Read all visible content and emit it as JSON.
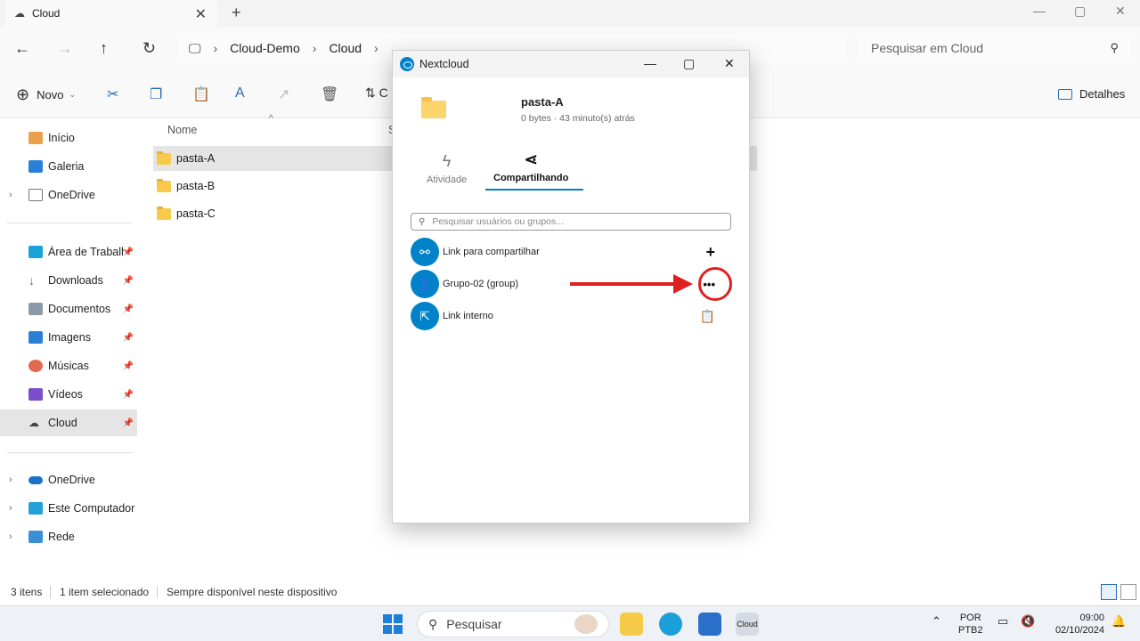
{
  "window": {
    "tab_title": "Cloud",
    "close": "✕",
    "new_tab": "+",
    "minimize": "—",
    "maximize": "▢",
    "close_window": "✕"
  },
  "address": {
    "path": [
      "Cloud-Demo",
      "Cloud"
    ],
    "search_placeholder": "Pesquisar em Cloud"
  },
  "toolbar": {
    "new_label": "Novo",
    "sort_label": "C",
    "details_label": "Detalhes"
  },
  "sidebar": {
    "items": [
      {
        "label": "Início"
      },
      {
        "label": "Galeria"
      },
      {
        "label": "OneDrive"
      },
      {
        "label": "Área de Trabalho"
      },
      {
        "label": "Downloads"
      },
      {
        "label": "Documentos"
      },
      {
        "label": "Imagens"
      },
      {
        "label": "Músicas"
      },
      {
        "label": "Vídeos"
      },
      {
        "label": "Cloud"
      },
      {
        "label": "OneDrive"
      },
      {
        "label": "Este Computador"
      },
      {
        "label": "Rede"
      }
    ]
  },
  "filelist": {
    "col_name": "Nome",
    "col_status": "S",
    "rows": [
      {
        "name": "pasta-A"
      },
      {
        "name": "pasta-B"
      },
      {
        "name": "pasta-C"
      }
    ]
  },
  "statusbar": {
    "count": "3 itens",
    "selected": "1 item selecionado",
    "availability": "Sempre disponível neste dispositivo"
  },
  "dialog": {
    "title": "Nextcloud",
    "file_name": "pasta-A",
    "file_meta": "0 bytes · 43 minuto(s) atrás",
    "tabs": [
      {
        "label": "Atividade"
      },
      {
        "label": "Compartilhando"
      }
    ],
    "search_placeholder": "Pesquisar usuários ou grupos...",
    "shares": [
      {
        "label": "Link para compartilhar",
        "action": "+"
      },
      {
        "label": "Grupo-02 (group)",
        "action": "•••"
      },
      {
        "label": "Link interno",
        "action": "📋"
      }
    ]
  },
  "taskbar": {
    "search_label": "Pesquisar",
    "lang_top": "POR",
    "lang_bottom": "PTB2",
    "time": "09:00",
    "date": "02/10/2024",
    "cloud_app_label": "Cloud"
  }
}
